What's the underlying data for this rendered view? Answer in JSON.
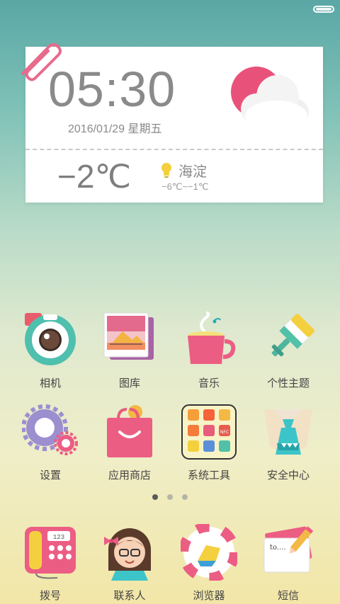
{
  "status_bar": {
    "battery": "battery-full"
  },
  "widget": {
    "time": "05:30",
    "date": "2016/01/29  星期五",
    "temperature": "−2℃",
    "location": "海淀",
    "range": "−6℃~−1℃",
    "icon": "cloudy-sun-icon"
  },
  "apps_row1": [
    {
      "label": "相机",
      "name": "camera"
    },
    {
      "label": "图库",
      "name": "gallery"
    },
    {
      "label": "音乐",
      "name": "music"
    },
    {
      "label": "个性主题",
      "name": "themes"
    }
  ],
  "apps_row2": [
    {
      "label": "设置",
      "name": "settings"
    },
    {
      "label": "应用商店",
      "name": "app-store"
    },
    {
      "label": "系统工具",
      "name": "system-tools"
    },
    {
      "label": "安全中心",
      "name": "security-center"
    }
  ],
  "folder": {
    "nfc_label": "NFC"
  },
  "page_indicator": {
    "pages": 3,
    "active": 1
  },
  "dock": [
    {
      "label": "拨号",
      "name": "dialer"
    },
    {
      "label": "联系人",
      "name": "contacts"
    },
    {
      "label": "浏览器",
      "name": "browser"
    },
    {
      "label": "短信",
      "name": "messages"
    }
  ],
  "phone_digits": "123",
  "note_text": "to...."
}
